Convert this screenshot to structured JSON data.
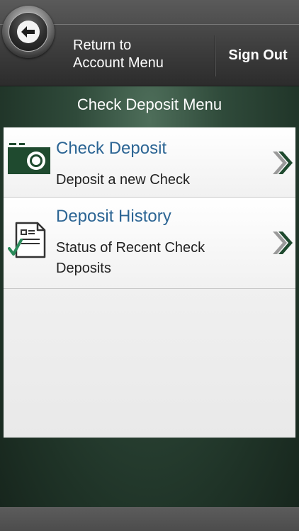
{
  "header": {
    "return_label_line1": "Return to",
    "return_label_line2": "Account Menu",
    "sign_out_label": "Sign Out"
  },
  "menu": {
    "title": "Check Deposit Menu",
    "items": [
      {
        "title": "Check Deposit",
        "description": "Deposit a new Check",
        "icon": "camera-icon"
      },
      {
        "title": "Deposit History",
        "description_line1": "Status of Recent Check",
        "description_line2": "Deposits",
        "icon": "document-check-icon"
      }
    ]
  },
  "colors": {
    "accent_green": "#1f4a2f",
    "link_blue": "#2c6594"
  }
}
